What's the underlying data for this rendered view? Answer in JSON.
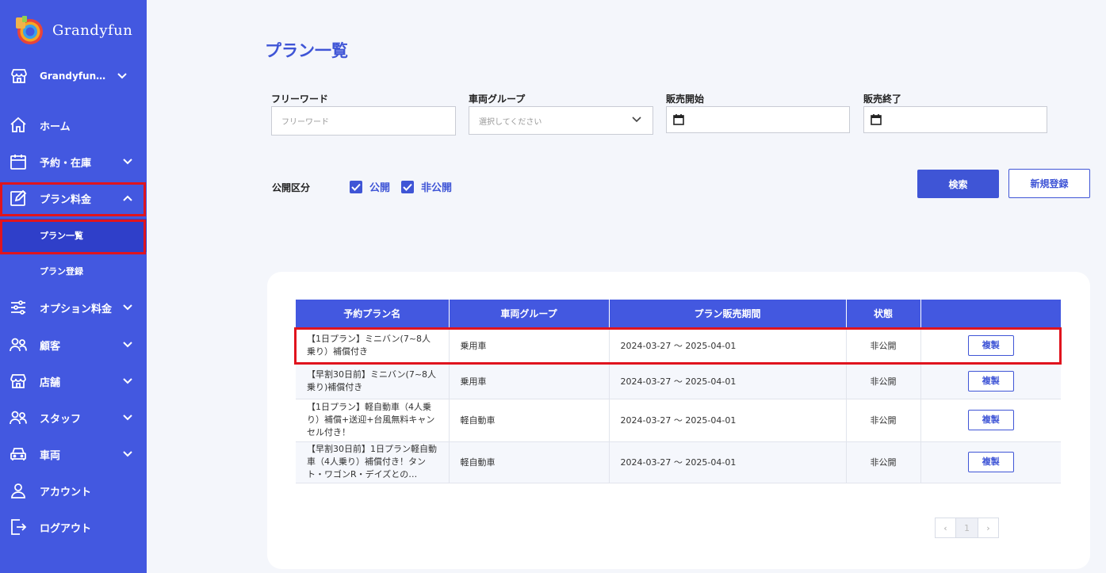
{
  "brand": {
    "name": "Grandyfun"
  },
  "store_selector": {
    "label": "Grandyfun…"
  },
  "nav": [
    {
      "key": "home",
      "label": "ホーム",
      "icon": "home-icon",
      "has_chevron": false
    },
    {
      "key": "reservations",
      "label": "予約・在庫",
      "icon": "calendar-icon",
      "has_chevron": true
    },
    {
      "key": "plans",
      "label": "プラン料金",
      "icon": "edit-icon",
      "has_chevron": true,
      "expanded": true
    },
    {
      "key": "options",
      "label": "オプション料金",
      "icon": "sliders-icon",
      "has_chevron": true
    },
    {
      "key": "customers",
      "label": "顧客",
      "icon": "users-icon",
      "has_chevron": true
    },
    {
      "key": "stores",
      "label": "店舗",
      "icon": "store-icon",
      "has_chevron": true
    },
    {
      "key": "staff",
      "label": "スタッフ",
      "icon": "staff-icon",
      "has_chevron": true
    },
    {
      "key": "vehicles",
      "label": "車両",
      "icon": "car-icon",
      "has_chevron": true
    },
    {
      "key": "account",
      "label": "アカウント",
      "icon": "user-icon",
      "has_chevron": false
    },
    {
      "key": "logout",
      "label": "ログアウト",
      "icon": "logout-icon",
      "has_chevron": false
    }
  ],
  "subnav": [
    {
      "label": "プラン一覧",
      "active": true
    },
    {
      "label": "プラン登録",
      "active": false
    }
  ],
  "page": {
    "title": "プラン一覧"
  },
  "filters": {
    "freeword": {
      "label": "フリーワード",
      "placeholder": "フリーワード"
    },
    "vehicle_group": {
      "label": "車両グループ",
      "placeholder": "選択してください"
    },
    "sale_start": {
      "label": "販売開始"
    },
    "sale_end": {
      "label": "販売終了"
    },
    "visibility": {
      "label": "公開区分",
      "public": "公開",
      "private": "非公開",
      "public_checked": true,
      "private_checked": true
    },
    "search_button": "検索",
    "new_button": "新規登録"
  },
  "table": {
    "columns": [
      "予約プラン名",
      "車両グループ",
      "プラン販売期間",
      "状態",
      ""
    ],
    "rows": [
      {
        "name": "【1日プラン】ミニバン(7~8人乗り）補償付き",
        "group": "乗用車",
        "period": "2024-03-27 ～ 2025-04-01",
        "status": "非公開",
        "action": "複製"
      },
      {
        "name": "【早割30日前】ミニバン(7~8人乗り)補償付き",
        "group": "乗用車",
        "period": "2024-03-27 ～ 2025-04-01",
        "status": "非公開",
        "action": "複製"
      },
      {
        "name": "【1日プラン】軽自動車（4人乗り）補償+送迎+台風無料キャンセル付き！",
        "group": "軽自動車",
        "period": "2024-03-27 ～ 2025-04-01",
        "status": "非公開",
        "action": "複製"
      },
      {
        "name": "【早割30日前】1日プラン軽自動車（4人乗り）補償付き！タント・ワゴンR・デイズとの…",
        "group": "軽自動車",
        "period": "2024-03-27 ～ 2025-04-01",
        "status": "非公開",
        "action": "複製"
      }
    ]
  },
  "pagination": {
    "current": "1",
    "prev": "‹",
    "next": "›"
  },
  "colors": {
    "sidebar": "#4358e0",
    "accent": "#3f55d6",
    "highlight": "#e0141e",
    "active_sub": "#2f3fc9"
  }
}
